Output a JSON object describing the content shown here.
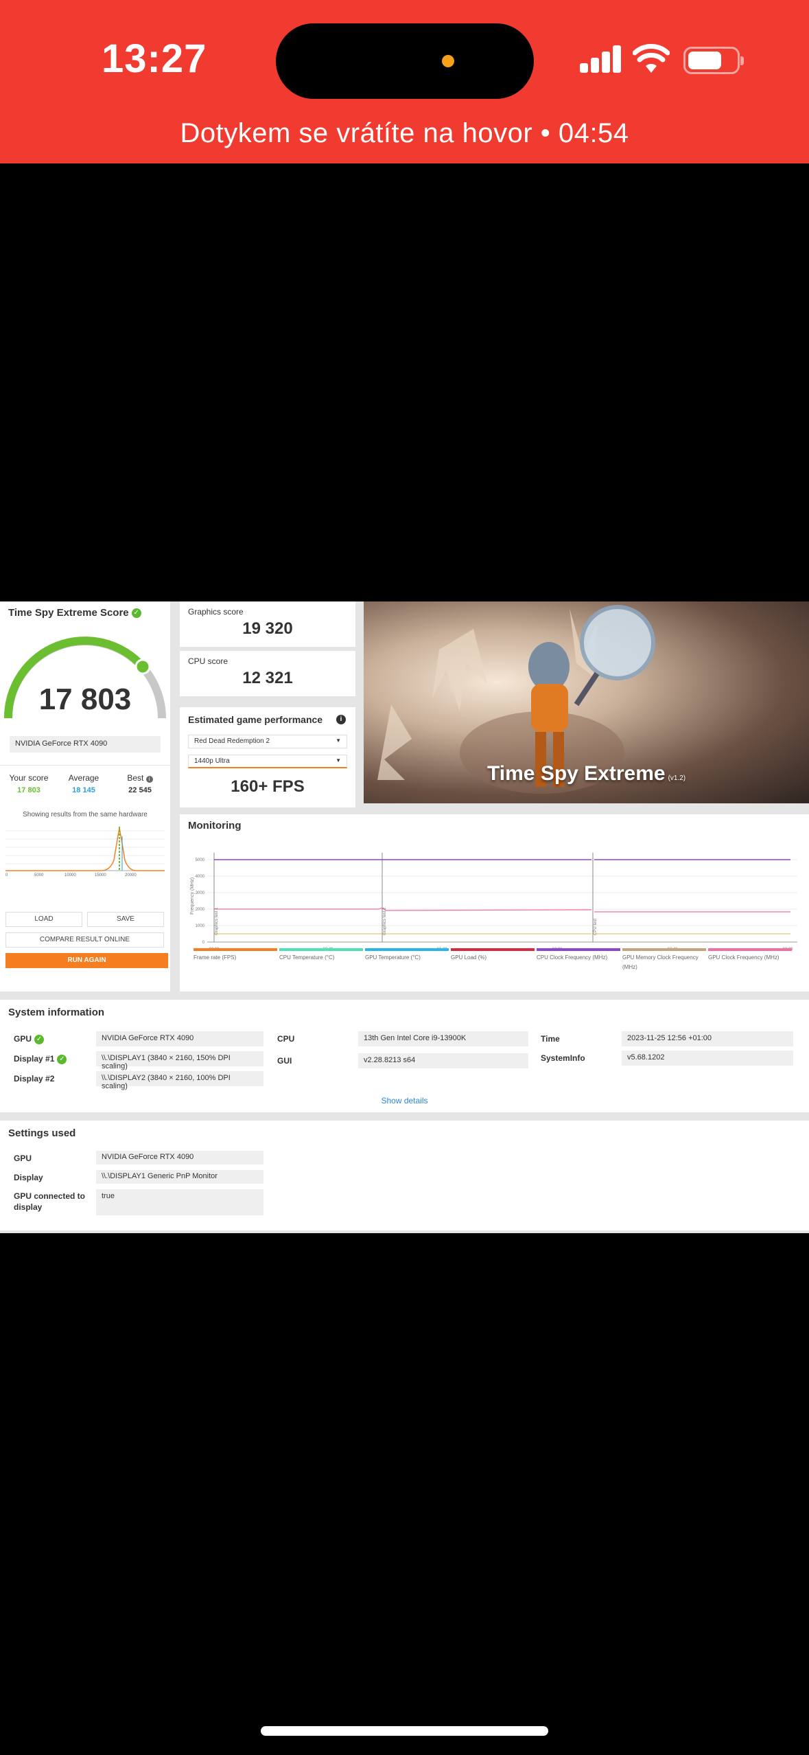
{
  "status_bar": {
    "time": "13:27",
    "call_banner": "Dotykem se vrátíte na hovor • 04:54",
    "battery_level": 0.7
  },
  "score": {
    "title": "Time Spy Extreme Score",
    "value": "17 803",
    "gpu": "NVIDIA GeForce RTX 4090",
    "your_score_label": "Your score",
    "your_score": "17 803",
    "average_label": "Average",
    "average": "18 145",
    "best_label": "Best",
    "best": "22 545",
    "hist_title": "Showing results from the same hardware",
    "hist_ticks": [
      "0",
      "5000",
      "10000",
      "15000",
      "20000"
    ],
    "load": "LOAD",
    "save": "SAVE",
    "compare": "COMPARE RESULT ONLINE",
    "run_again": "RUN AGAIN"
  },
  "graphics": {
    "label": "Graphics score",
    "value": "19 320"
  },
  "cpu_score": {
    "label": "CPU score",
    "value": "12 321"
  },
  "estimated": {
    "title": "Estimated game performance",
    "game": "Red Dead Redemption 2",
    "preset": "1440p Ultra",
    "fps": "160+ FPS"
  },
  "hero": {
    "title": "Time Spy Extreme",
    "version": "(v1.2)"
  },
  "monitoring": {
    "title": "Monitoring",
    "y_label": "Frequency (MHz)",
    "y_ticks": [
      "5000",
      "4000",
      "3000",
      "2000",
      "1000",
      "0"
    ],
    "x_ticks": [
      "00:00",
      "00:40",
      "01:20",
      "02:00",
      "02:40",
      "03:20"
    ],
    "markers": [
      "Graphics test 1",
      "Graphics test 2",
      "CPU test"
    ],
    "legend": [
      {
        "name": "Frame rate (FPS)",
        "color": "#f57f20"
      },
      {
        "name": "CPU Temperature (°C)",
        "color": "#4de2b6"
      },
      {
        "name": "GPU Temperature (°C)",
        "color": "#26b7e8"
      },
      {
        "name": "GPU Load (%)",
        "color": "#d9293e"
      },
      {
        "name": "CPU Clock Frequency (MHz)",
        "color": "#8b47c9"
      },
      {
        "name": "GPU Memory Clock Frequency (MHz)",
        "color": "#c4a57a"
      },
      {
        "name": "GPU Clock Frequency (MHz)",
        "color": "#f06ea0"
      }
    ]
  },
  "system": {
    "title": "System information",
    "gpu_label": "GPU",
    "gpu": "NVIDIA GeForce RTX 4090",
    "display1_label": "Display #1",
    "display1": "\\\\.\\DISPLAY1 (3840 × 2160, 150% DPI scaling)",
    "display2_label": "Display #2",
    "display2": "\\\\.\\DISPLAY2 (3840 × 2160, 100% DPI scaling)",
    "cpu_label": "CPU",
    "cpu": "13th Gen Intel Core i9-13900K",
    "gui_label": "GUI",
    "gui": "v2.28.8213 s64",
    "time_label": "Time",
    "time": "2023-11-25 12:56 +01:00",
    "sysinfo_label": "SystemInfo",
    "sysinfo": "v5.68.1202",
    "show_details": "Show details"
  },
  "settings": {
    "title": "Settings used",
    "gpu_label": "GPU",
    "gpu": "NVIDIA GeForce RTX 4090",
    "display_label": "Display",
    "display": "\\\\.\\DISPLAY1 Generic PnP Monitor",
    "connected_label": "GPU connected to display",
    "connected": "true"
  },
  "colors": {
    "status_bar": "#f23b30",
    "accent_orange": "#f57f20",
    "score_green": "#6abe2f",
    "average_blue": "#2a9fd8"
  }
}
